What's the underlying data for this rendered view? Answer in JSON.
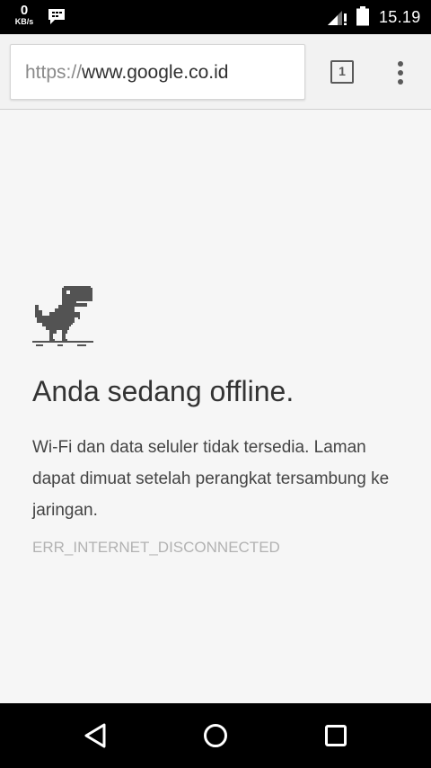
{
  "status_bar": {
    "net_speed_value": "0",
    "net_speed_unit": "KB/s",
    "time": "15.19",
    "notification_icon": "bbm-icon",
    "signal_icon": "signal-no-service-icon",
    "battery_icon": "battery-icon"
  },
  "toolbar": {
    "url_scheme": "https://",
    "url_host": "www.google.co.id",
    "tab_count": "1",
    "menu_icon": "overflow-menu-icon"
  },
  "error_page": {
    "title": "Anda sedang offline.",
    "message": "Wi-Fi dan data seluler tidak tersedia. Laman dapat dimuat setelah perangkat tersambung ke jaringan.",
    "error_code": "ERR_INTERNET_DISCONNECTED",
    "illustration": "offline-dino-icon"
  },
  "nav_bar": {
    "back_icon": "back-triangle-icon",
    "home_icon": "home-circle-icon",
    "recents_icon": "recents-square-icon"
  },
  "colors": {
    "status_bar_bg": "#000000",
    "toolbar_bg": "#f2f2f2",
    "page_bg": "#f6f6f6",
    "dino": "#535353",
    "headline_text": "#333333",
    "error_code_text": "#b2b2b2"
  }
}
